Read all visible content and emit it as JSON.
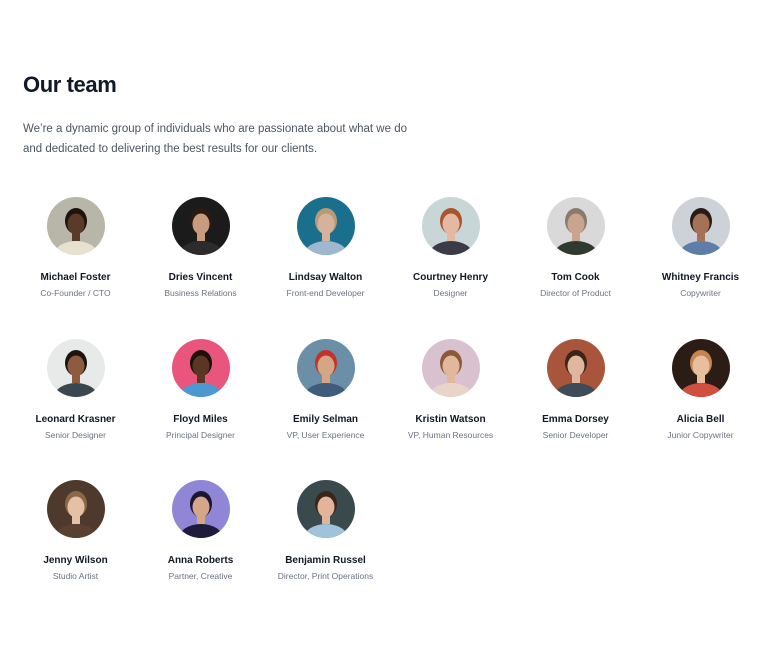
{
  "section": {
    "title": "Our team",
    "description_line1": "We’re a dynamic group of individuals who are passionate about what we do",
    "description_line2": "and dedicated to delivering the best results for our clients."
  },
  "members": [
    {
      "name": "Michael Foster",
      "role": "Co-Founder / CTO",
      "bg": "#b8b6a8",
      "skin": "#5a3b28",
      "hair": "#1f140d",
      "shirt": "#e7e2cf"
    },
    {
      "name": "Dries Vincent",
      "role": "Business Relations",
      "bg": "#1b1b1b",
      "skin": "#c99a7c",
      "hair": "#2b1a12",
      "shirt": "#2c2c2c"
    },
    {
      "name": "Lindsay Walton",
      "role": "Front-end Developer",
      "bg": "#1a6f8c",
      "skin": "#d6b29b",
      "hair": "#b89a76",
      "shirt": "#9fb8cf"
    },
    {
      "name": "Courtney Henry",
      "role": "Designer",
      "bg": "#c9d6d8",
      "skin": "#e3b9a3",
      "hair": "#a8542e",
      "shirt": "#3b3b48"
    },
    {
      "name": "Tom Cook",
      "role": "Director of Product",
      "bg": "#d9d9d9",
      "skin": "#c9a48e",
      "hair": "#8a7a6e",
      "shirt": "#2e3a2e"
    },
    {
      "name": "Whitney Francis",
      "role": "Copywriter",
      "bg": "#cdd2d8",
      "skin": "#a57258",
      "hair": "#2a1c14",
      "shirt": "#5d7ea6"
    },
    {
      "name": "Leonard Krasner",
      "role": "Senior Designer",
      "bg": "#e8eaea",
      "skin": "#8d5b3e",
      "hair": "#1d1410",
      "shirt": "#3a4650"
    },
    {
      "name": "Floyd Miles",
      "role": "Principal Designer",
      "bg": "#e9557d",
      "skin": "#5b3623",
      "hair": "#1a110c",
      "shirt": "#4a9ad1"
    },
    {
      "name": "Emily Selman",
      "role": "VP, User Experience",
      "bg": "#6a8fa7",
      "skin": "#d4a685",
      "hair": "#c3332a",
      "shirt": "#3f5d7a"
    },
    {
      "name": "Kristin Watson",
      "role": "VP, Human Resources",
      "bg": "#d9c2cf",
      "skin": "#e2b79c",
      "hair": "#8a5a38",
      "shirt": "#e8d5c8"
    },
    {
      "name": "Emma Dorsey",
      "role": "Senior Developer",
      "bg": "#a9553c",
      "skin": "#e0b69e",
      "hair": "#3b2418",
      "shirt": "#3e4c57"
    },
    {
      "name": "Alicia Bell",
      "role": "Junior Copywriter",
      "bg": "#2b1d16",
      "skin": "#e7bf9f",
      "hair": "#c4854f",
      "shirt": "#d14f3f"
    },
    {
      "name": "Jenny Wilson",
      "role": "Studio Artist",
      "bg": "#4e3a2c",
      "skin": "#e6c0a4",
      "hair": "#8a6846",
      "shirt": "#5a4030"
    },
    {
      "name": "Anna Roberts",
      "role": "Partner, Creative",
      "bg": "#8f86d6",
      "skin": "#d6a689",
      "hair": "#1c1630",
      "shirt": "#1e1b3c"
    },
    {
      "name": "Benjamin Russel",
      "role": "Director, Print Operations",
      "bg": "#394a4c",
      "skin": "#e2b59a",
      "hair": "#3a2618",
      "shirt": "#9fc3da"
    }
  ]
}
